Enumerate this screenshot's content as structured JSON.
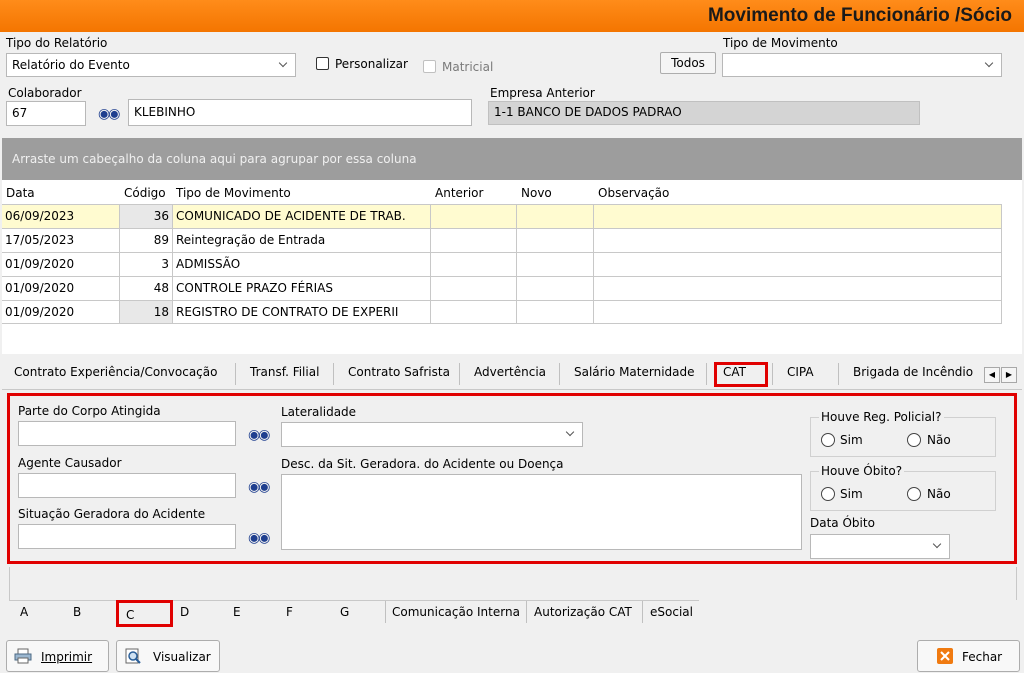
{
  "window": {
    "title": "Movimento de Funcionário /Sócio"
  },
  "report": {
    "type_label": "Tipo do Relatório",
    "type_value": "Relatório do Evento",
    "personalizar_label": "Personalizar",
    "matricial_label": "Matricial",
    "todos_label": "Todos",
    "movement_type_label": "Tipo de Movimento",
    "movement_type_value": ""
  },
  "colaborador": {
    "label": "Colaborador",
    "code": "67",
    "name": "KLEBINHO"
  },
  "empresa_anterior": {
    "label": "Empresa Anterior",
    "value": "1-1  BANCO DE DADOS PADRAO"
  },
  "group_hint": "Arraste um cabeçalho da coluna aqui para agrupar por essa coluna",
  "grid": {
    "headers": [
      "Data",
      "Código",
      "Tipo de Movimento",
      "Anterior",
      "Novo",
      "Observação"
    ],
    "rows": [
      {
        "data": "06/09/2023",
        "codigo": "36",
        "tipo": "COMUNICADO DE ACIDENTE DE TRAB.",
        "anterior": "",
        "novo": "",
        "obs": ""
      },
      {
        "data": "17/05/2023",
        "codigo": "89",
        "tipo": "Reintegração de Entrada",
        "anterior": "",
        "novo": "",
        "obs": ""
      },
      {
        "data": "01/09/2020",
        "codigo": "3",
        "tipo": "ADMISSÃO",
        "anterior": "",
        "novo": "",
        "obs": ""
      },
      {
        "data": "01/09/2020",
        "codigo": "48",
        "tipo": "CONTROLE PRAZO FÉRIAS",
        "anterior": "",
        "novo": "",
        "obs": ""
      },
      {
        "data": "01/09/2020",
        "codigo": "18",
        "tipo": "REGISTRO DE CONTRATO DE EXPERII",
        "anterior": "",
        "novo": "",
        "obs": ""
      }
    ]
  },
  "tabs": [
    "Contrato Experiência/Convocação",
    "Transf. Filial",
    "Contrato Safrista",
    "Advertência",
    "Salário Maternidade",
    "CAT",
    "CIPA",
    "Brigada de Incêndio"
  ],
  "active_tab": "CAT",
  "cat": {
    "parte_corpo_label": "Parte do Corpo Atingida",
    "parte_corpo_value": "",
    "lateralidade_label": "Lateralidade",
    "lateralidade_value": "",
    "agente_label": "Agente Causador",
    "agente_value": "",
    "desc_label": "Desc. da Sit. Geradora. do Acidente ou Doença",
    "desc_value": "",
    "situacao_label": "Situação Geradora do Acidente",
    "situacao_value": "",
    "policial_label": "Houve Reg. Policial?",
    "obito_label": "Houve Óbito?",
    "sim_label": "Sim",
    "nao_label": "Não",
    "data_obito_label": "Data Óbito",
    "data_obito_value": ""
  },
  "sub_tabs": [
    "A",
    "B",
    "C",
    "D",
    "E",
    "F",
    "G",
    "Comunicação Interna",
    "Autorização CAT",
    "eSocial"
  ],
  "active_sub_tab": "C",
  "footer": {
    "imprimir": "Imprimir",
    "visualizar": "Visualizar",
    "fechar": "Fechar"
  },
  "colors": {
    "title_bar": "#f47500",
    "highlight": "#e00000",
    "selected_row": "#fffbd0",
    "group_bar": "#9d9d9d"
  },
  "icons": [
    "binoculars-icon",
    "printer-icon",
    "preview-icon",
    "close-icon"
  ]
}
